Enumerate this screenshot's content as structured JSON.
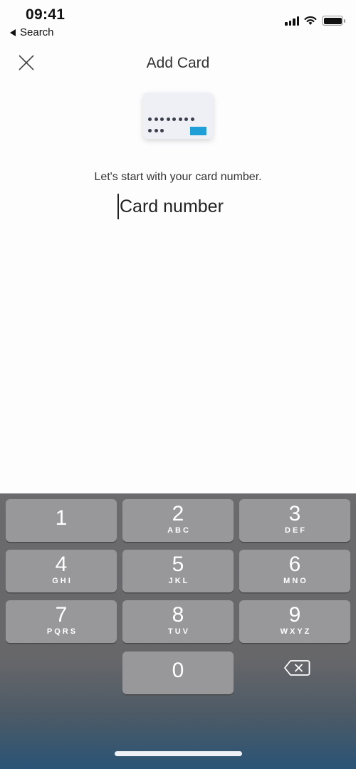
{
  "status_bar": {
    "time": "09:41",
    "back_label": "Search",
    "icons": [
      "cellular-signal-icon",
      "wifi-icon",
      "battery-icon"
    ]
  },
  "header": {
    "title": "Add Card",
    "close_icon": "close-icon"
  },
  "illustration": {
    "name": "credit-card-icon",
    "accent_color": "#1e9fd8"
  },
  "form": {
    "prompt": "Let's start with your card number.",
    "card_number_placeholder": "Card number",
    "card_number_value": ""
  },
  "keypad": {
    "keys": [
      {
        "digit": "1",
        "letters": ""
      },
      {
        "digit": "2",
        "letters": "ABC"
      },
      {
        "digit": "3",
        "letters": "DEF"
      },
      {
        "digit": "4",
        "letters": "GHI"
      },
      {
        "digit": "5",
        "letters": "JKL"
      },
      {
        "digit": "6",
        "letters": "MNO"
      },
      {
        "digit": "7",
        "letters": "PQRS"
      },
      {
        "digit": "8",
        "letters": "TUV"
      },
      {
        "digit": "9",
        "letters": "WXYZ"
      },
      {
        "digit": "0",
        "letters": ""
      }
    ],
    "delete_icon": "backspace-icon"
  }
}
